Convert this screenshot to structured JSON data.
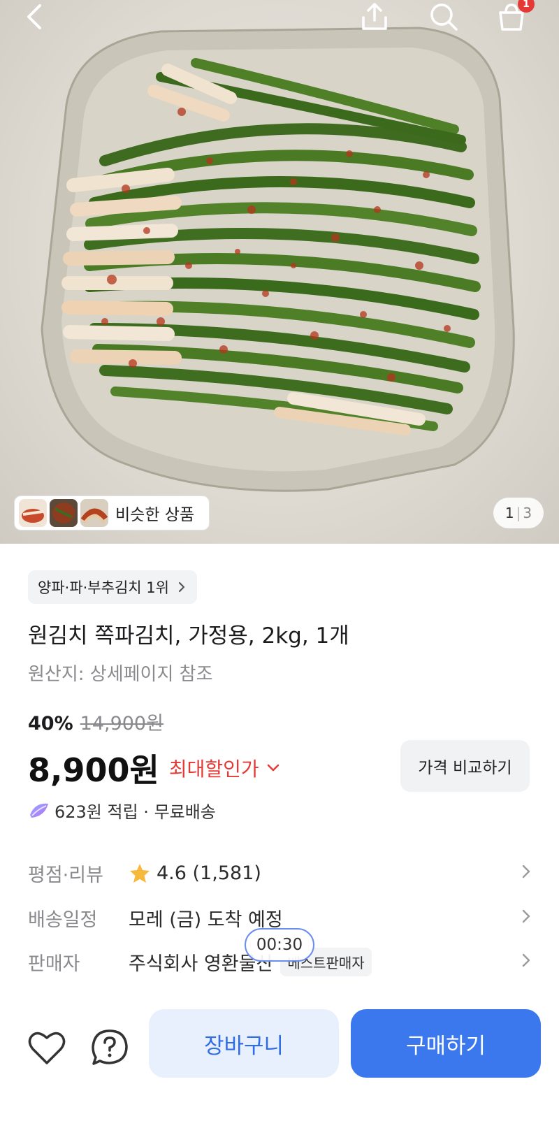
{
  "hero": {
    "image_alt": "쪽파김치",
    "similar_label": "비슷한 상품",
    "page_current": "1",
    "page_total": "3",
    "cart_count": "1"
  },
  "product": {
    "rank_chip": "양파·파·부추김치 1위",
    "title": "원김치 쪽파김치, 가정용, 2kg, 1개",
    "origin": "원산지: 상세페이지 참조",
    "discount_pct": "40%",
    "original_price": "14,900원",
    "sale_price": "8,900원",
    "max_discount_label": "최대할인가",
    "compare_button": "가격 비교하기",
    "points_text": "623원 적립 · 무료배송"
  },
  "info": {
    "rating_label": "평점·리뷰",
    "rating_value": "4.6 (1,581)",
    "delivery_label": "배송일정",
    "delivery_value": "모레 (금) 도착 예정",
    "seller_label": "판매자",
    "seller_value": "주식회사 영환물산",
    "seller_badge": "베스트판매자"
  },
  "overlay": {
    "timer": "00:30"
  },
  "bottom_bar": {
    "cart_button": "장바구니",
    "buy_button": "구매하기"
  },
  "colors": {
    "accent_blue": "#3b78ee",
    "light_blue": "#e9f0fd",
    "discount_red": "#e53935",
    "star_yellow": "#f6b93b"
  }
}
